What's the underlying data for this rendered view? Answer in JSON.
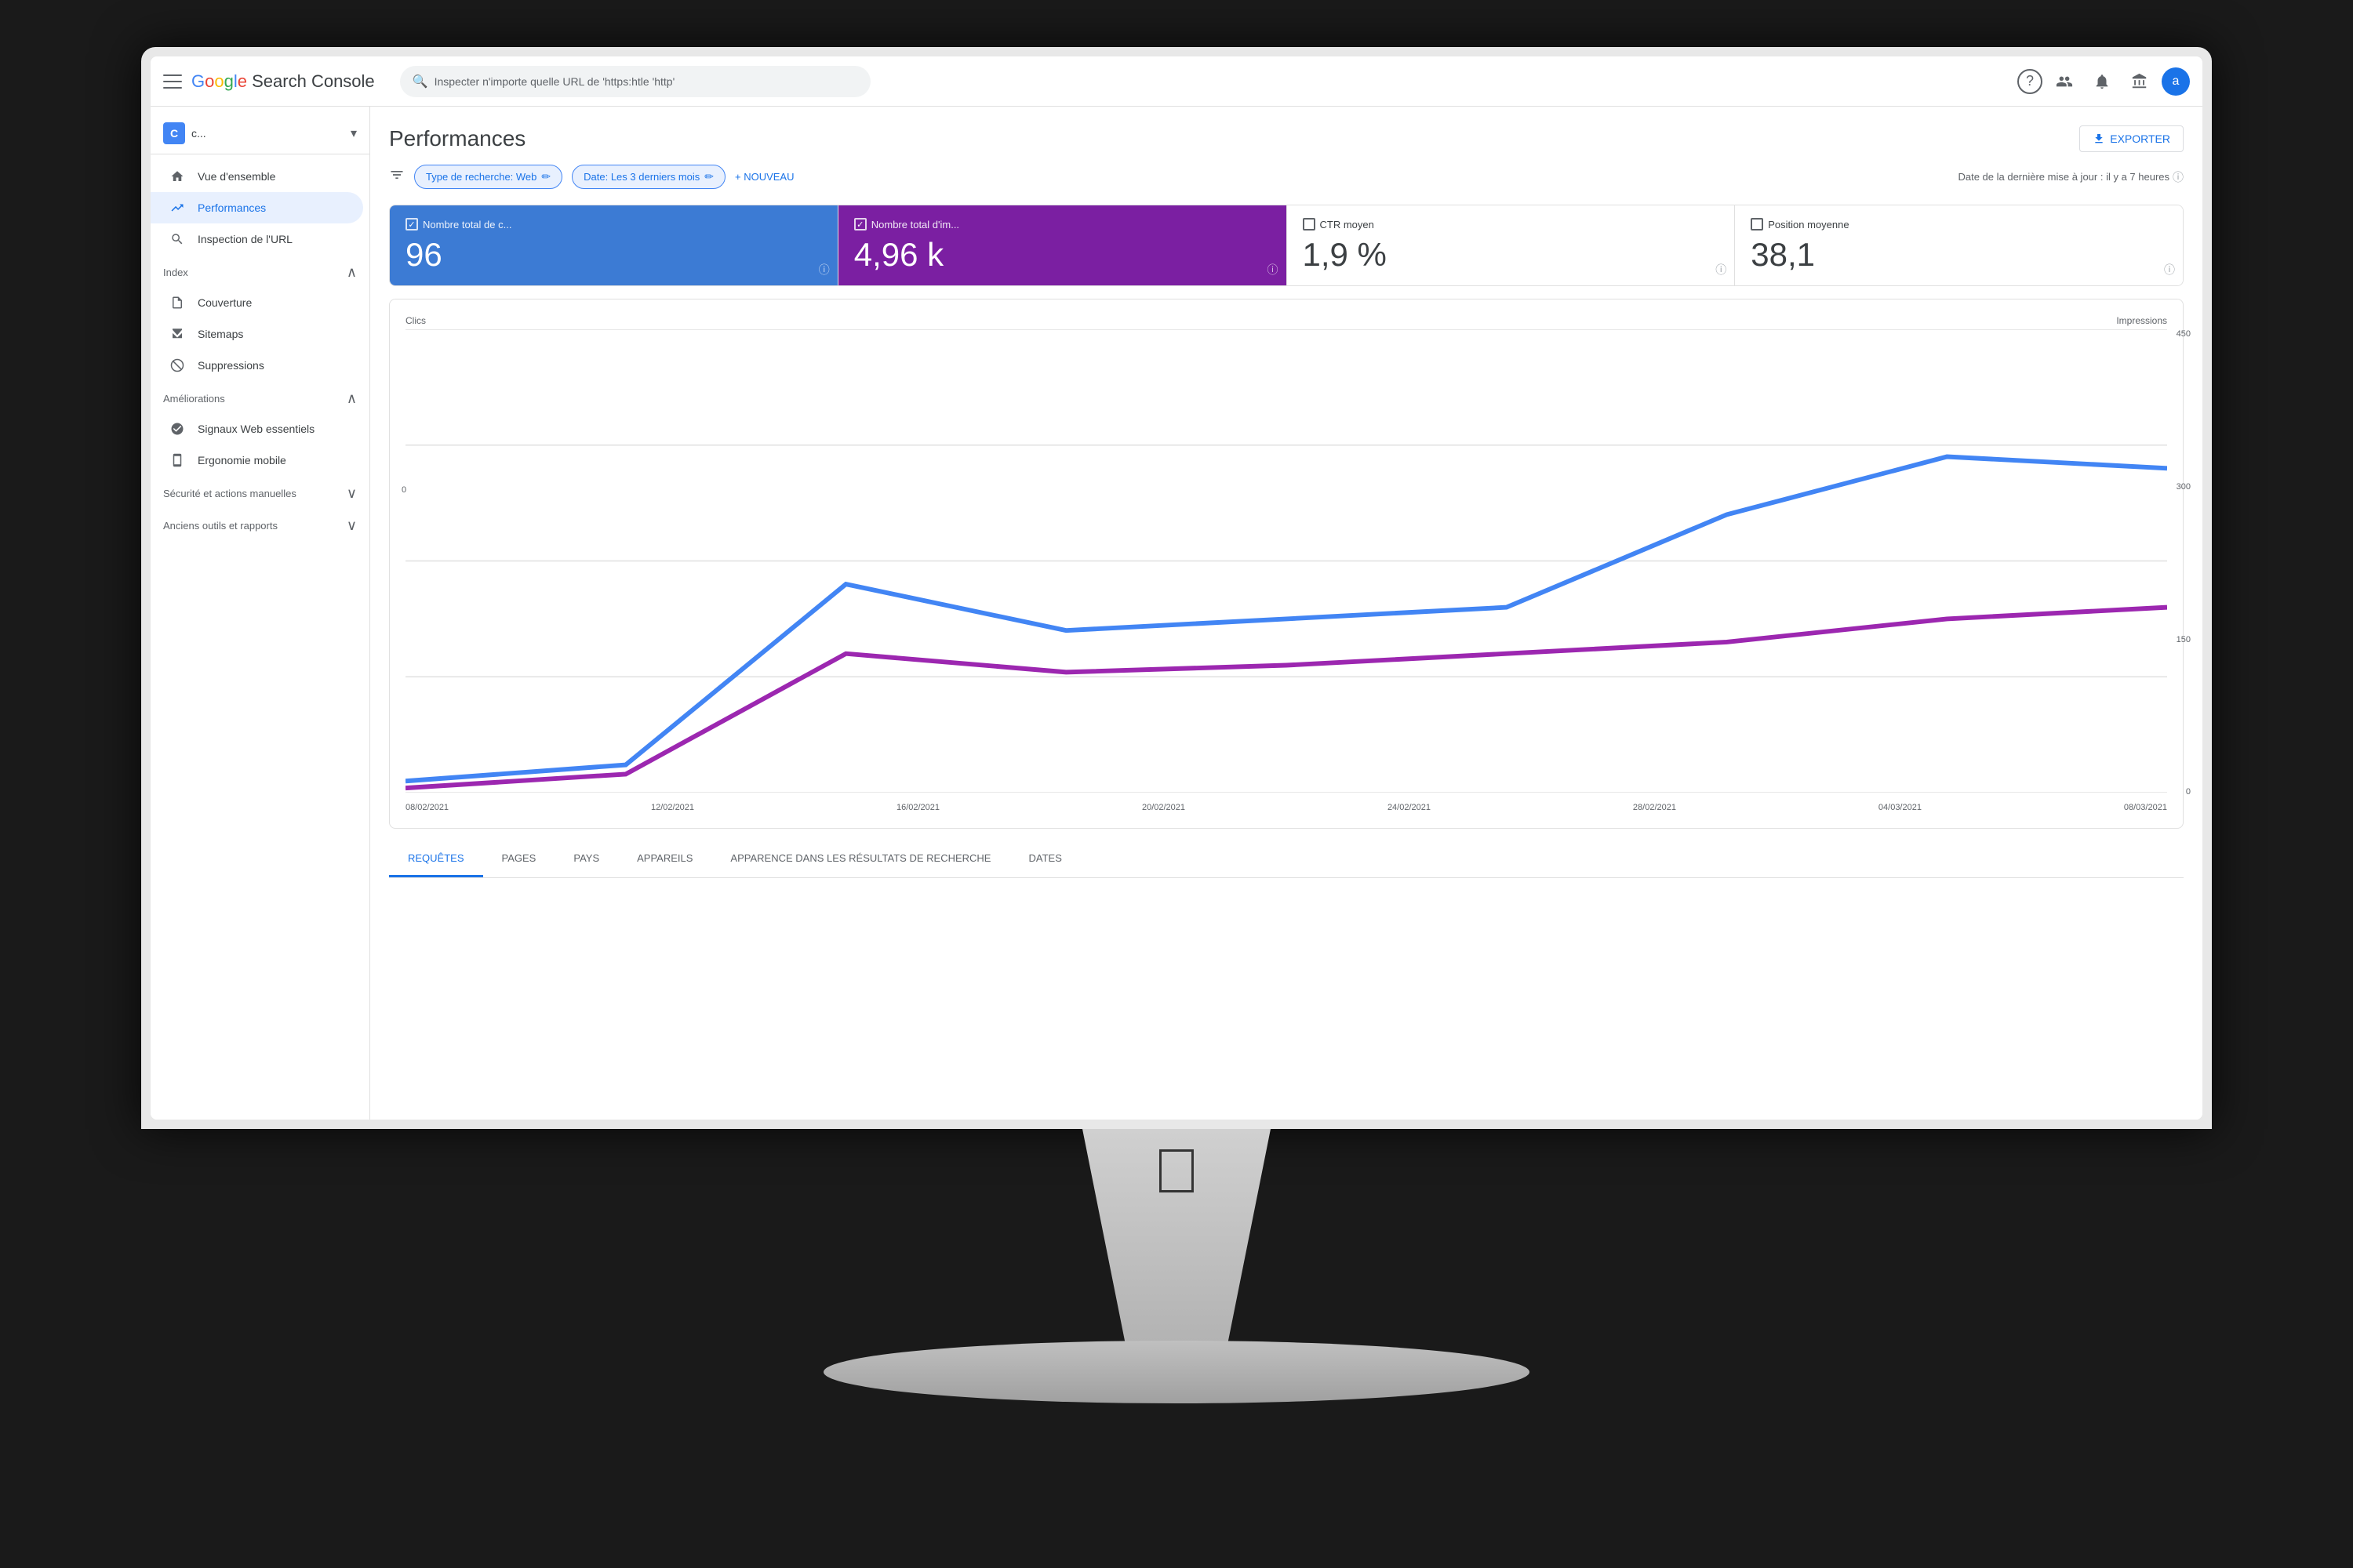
{
  "brand": {
    "name": "Google Search Console",
    "name_parts": [
      "G",
      "o",
      "o",
      "g",
      "l",
      "e",
      " ",
      "S",
      "e",
      "a",
      "r",
      "c",
      "h",
      " ",
      "C",
      "o",
      "n",
      "s",
      "o",
      "l",
      "e"
    ]
  },
  "search": {
    "placeholder": "Inspecter n'importe quelle URL de 'https:htle 'http'"
  },
  "nav_icons": {
    "help": "?",
    "people": "👤",
    "bell": "🔔",
    "grid": "⊞",
    "avatar": "a"
  },
  "sidebar": {
    "property": {
      "icon_letter": "C",
      "name": "c..."
    },
    "items": [
      {
        "id": "vue-ensemble",
        "label": "Vue d'ensemble",
        "icon": "🏠",
        "active": false
      },
      {
        "id": "performances",
        "label": "Performances",
        "icon": "📈",
        "active": true
      },
      {
        "id": "inspection-url",
        "label": "Inspection de l'URL",
        "icon": "🔍",
        "active": false
      }
    ],
    "sections": [
      {
        "title": "Index",
        "items": [
          {
            "id": "couverture",
            "label": "Couverture",
            "icon": "📄"
          },
          {
            "id": "sitemaps",
            "label": "Sitemaps",
            "icon": "🗺"
          },
          {
            "id": "suppressions",
            "label": "Suppressions",
            "icon": "🚫"
          }
        ]
      },
      {
        "title": "Améliorations",
        "items": [
          {
            "id": "signaux-web",
            "label": "Signaux Web essentiels",
            "icon": "⚙"
          },
          {
            "id": "ergonomie",
            "label": "Ergonomie mobile",
            "icon": "📱"
          }
        ]
      },
      {
        "title": "Sécurité et actions manuelles",
        "items": []
      },
      {
        "title": "Anciens outils et rapports",
        "items": []
      }
    ]
  },
  "main": {
    "title": "Performances",
    "export_label": "EXPORTER",
    "filters": {
      "type_recherche": "Type de recherche: Web",
      "date": "Date: Les 3 derniers mois",
      "add_label": "+ NOUVEAU",
      "last_update": "Date de la dernière mise à jour : il y a 7 heures"
    },
    "metrics": [
      {
        "id": "clics",
        "label": "Nombre total de c...",
        "value": "96",
        "type": "blue",
        "checked": true
      },
      {
        "id": "impressions",
        "label": "Nombre total d'im...",
        "value": "4,96 k",
        "type": "purple",
        "checked": true
      },
      {
        "id": "ctr",
        "label": "CTR moyen",
        "value": "1,9 %",
        "type": "white",
        "checked": false
      },
      {
        "id": "position",
        "label": "Position moyenne",
        "value": "38,1",
        "type": "white",
        "checked": false
      }
    ],
    "chart": {
      "y_left_label": "Clics",
      "y_right_label": "Impressions",
      "y_right_values": [
        "450",
        "300",
        "150",
        "0"
      ],
      "y_left_values": [
        "0"
      ],
      "x_labels": [
        "08/02/2021",
        "12/02/2021",
        "16/02/2021",
        "20/02/2021",
        "24/02/2021",
        "28/02/2021",
        "04/03/2021",
        "08/03/2021"
      ]
    },
    "tabs": [
      {
        "id": "requetes",
        "label": "REQUÊTES",
        "active": true
      },
      {
        "id": "pages",
        "label": "PAGES",
        "active": false
      },
      {
        "id": "pays",
        "label": "PAYS",
        "active": false
      },
      {
        "id": "appareils",
        "label": "APPAREILS",
        "active": false
      },
      {
        "id": "apparence",
        "label": "APPARENCE DANS LES RÉSULTATS DE RECHERCHE",
        "active": false
      },
      {
        "id": "dates",
        "label": "DATES",
        "active": false
      }
    ]
  }
}
